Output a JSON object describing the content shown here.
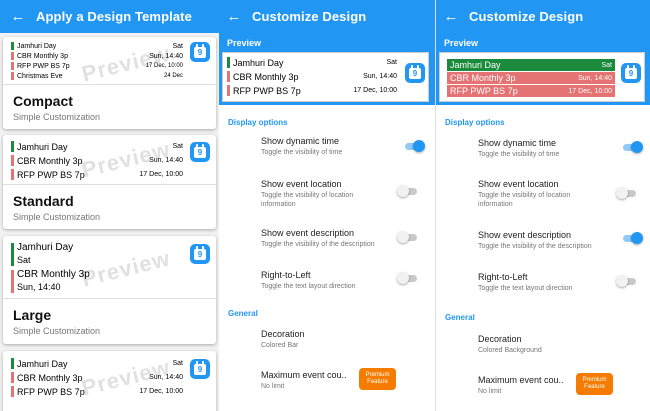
{
  "colors": {
    "primary": "#2196f3",
    "green": "#1b8a3d",
    "salmon": "#e57373",
    "premium": "#f57c00"
  },
  "panel1": {
    "title": "Apply a Design Template",
    "back_icon": "arrow-left-icon",
    "watermark": "Preview",
    "calendar_day": "9",
    "cards": [
      {
        "name": "Compact",
        "sub": "Simple Customization",
        "events": [
          {
            "title": "Jamhuri Day",
            "time": "Sat"
          },
          {
            "title": "CBR Monthly 3p",
            "time": "Sun, 14:40"
          },
          {
            "title": "RFP PWP BS 7p",
            "time": "17 Dec, 10:00"
          },
          {
            "title": "Christmas Eve",
            "time": "24 Dec"
          }
        ]
      },
      {
        "name": "Standard",
        "sub": "Simple Customization",
        "events": [
          {
            "title": "Jamhuri Day",
            "time": "Sat"
          },
          {
            "title": "CBR Monthly 3p",
            "time": "Sun, 14:40"
          },
          {
            "title": "RFP PWP BS 7p",
            "time": "17 Dec, 10:00"
          }
        ]
      },
      {
        "name": "Large",
        "sub": "Simple Customization",
        "events": [
          {
            "title": "Jamhuri Day",
            "time": "Sat"
          },
          {
            "title": "CBR Monthly 3p",
            "time": "Sun, 14:40"
          }
        ]
      },
      {
        "name": "",
        "sub": "",
        "events": [
          {
            "title": "Jamhuri Day",
            "time": "Sat"
          },
          {
            "title": "CBR Monthly 3p",
            "time": "Sun, 14:40"
          },
          {
            "title": "RFP PWP BS 7p",
            "time": "17 Dec, 10:00"
          }
        ]
      }
    ]
  },
  "panel2": {
    "title": "Customize Design",
    "preview_label": "Preview",
    "events": [
      {
        "title": "Jamhuri Day",
        "time": "Sat"
      },
      {
        "title": "CBR Monthly 3p",
        "time": "Sun, 14:40"
      },
      {
        "title": "RFP PWP BS 7p",
        "time": "17 Dec, 10:00"
      }
    ],
    "display_header": "Display options",
    "options": [
      {
        "title": "Show dynamic time",
        "sub": "Toggle the visibility of time",
        "on": true
      },
      {
        "title": "Show event location",
        "sub": "Toggle the visibility of location information",
        "on": false
      },
      {
        "title": "Show event description",
        "sub": "Toggle the visibility of the description",
        "on": false
      },
      {
        "title": "Right-to-Left",
        "sub": "Toggle the text layout direction",
        "on": false
      }
    ],
    "general_header": "General",
    "decoration_title": "Decoration",
    "decoration_value": "Colored Bar",
    "max_title": "Maximum event cou..",
    "max_value": "No limit",
    "premium_label": "Premium Feature"
  },
  "panel3": {
    "title": "Customize Design",
    "preview_label": "Preview",
    "events": [
      {
        "title": "Jamhuri Day",
        "time": "Sat"
      },
      {
        "title": "CBR Monthly 3p",
        "time": "Sun, 14:40"
      },
      {
        "title": "RFP PWP BS 7p",
        "time": "17 Dec, 10:00"
      }
    ],
    "display_header": "Display options",
    "options": [
      {
        "title": "Show dynamic time",
        "sub": "Toggle the visibility of time",
        "on": true
      },
      {
        "title": "Show event location",
        "sub": "Toggle the visibility of location information",
        "on": false
      },
      {
        "title": "Show event description",
        "sub": "Toggle the visibility of the description",
        "on": true
      },
      {
        "title": "Right-to-Left",
        "sub": "Toggle the text layout direction",
        "on": false
      }
    ],
    "general_header": "General",
    "decoration_title": "Decoration",
    "decoration_value": "Colored Background",
    "max_title": "Maximum event cou..",
    "max_value": "No limit",
    "premium_label": "Premium Feature"
  }
}
